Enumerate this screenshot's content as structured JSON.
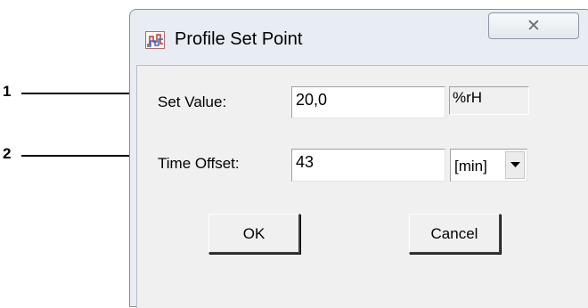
{
  "callouts": [
    "1",
    "2"
  ],
  "dialog": {
    "title": "Profile Set Point",
    "close_glyph": "✕",
    "set_value": {
      "label": "Set Value:",
      "value": "20,0",
      "unit": "%rH"
    },
    "time_offset": {
      "label": "Time Offset:",
      "value": "43",
      "unit_selected": "[min]"
    },
    "buttons": {
      "ok": "OK",
      "cancel": "Cancel"
    }
  }
}
